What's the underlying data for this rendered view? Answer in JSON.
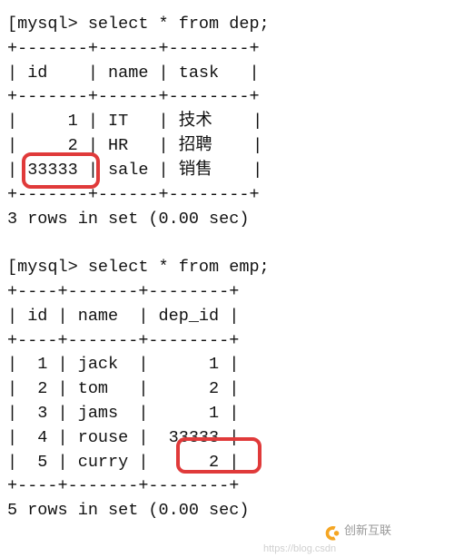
{
  "block1": {
    "prompt": "[mysql> select * from dep;",
    "sep": "+-------+------+--------+",
    "hdr": "| id    | name | task   |",
    "rows": [
      "|     1 | IT   | 技术    |",
      "|     2 | HR   | 招聘    |",
      "| 33333 | sale | 销售    |"
    ],
    "footer": "3 rows in set (0.00 sec)"
  },
  "block2": {
    "prompt": "[mysql> select * from emp;",
    "sep": "+----+-------+--------+",
    "hdr": "| id | name  | dep_id |",
    "rows": [
      "|  1 | jack  |      1 |",
      "|  2 | tom   |      2 |",
      "|  3 | jams  |      1 |",
      "|  4 | rouse |  33333 |",
      "|  5 | curry |      2 |"
    ],
    "footer": "5 rows in set (0.00 sec)"
  },
  "watermark_text": "创新互联",
  "faint_url": "https://blog.csdn"
}
